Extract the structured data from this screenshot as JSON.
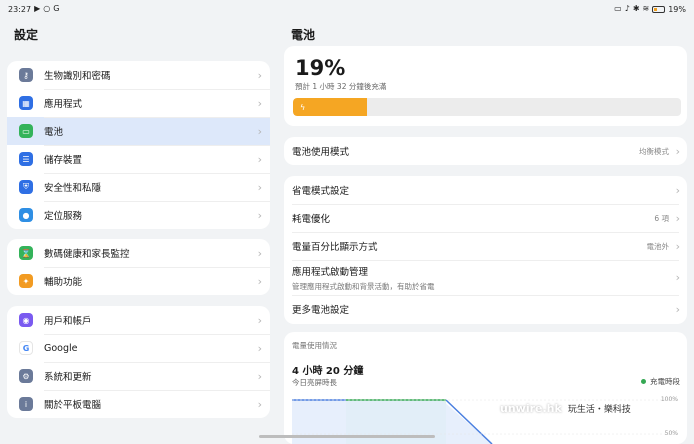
{
  "statusbar": {
    "time": "23:27",
    "battery_pct": "19%"
  },
  "left": {
    "title": "設定",
    "groups": [
      {
        "items": [
          {
            "label": "生物識別和密碼",
            "color": "#6b7a99",
            "glyph": "⚷"
          },
          {
            "label": "應用程式",
            "color": "#2f6fe4",
            "glyph": "▦"
          },
          {
            "label": "電池",
            "color": "#34b35a",
            "glyph": "▭",
            "selected": true
          },
          {
            "label": "儲存裝置",
            "color": "#2f6fe4",
            "glyph": "☰"
          },
          {
            "label": "安全性和私隱",
            "color": "#2f6fe4",
            "glyph": "⛨"
          },
          {
            "label": "定位服務",
            "color": "#2f8fe4",
            "glyph": "●"
          }
        ]
      },
      {
        "items": [
          {
            "label": "數碼健康和家長監控",
            "color": "#34b35a",
            "glyph": "⌛"
          },
          {
            "label": "輔助功能",
            "color": "#f29b22",
            "glyph": "✦"
          }
        ]
      },
      {
        "items": [
          {
            "label": "用戶和帳戶",
            "color": "#7a5af0",
            "glyph": "◉"
          },
          {
            "label": "Google",
            "color": "#ffffff",
            "glyph": "G",
            "text_color": "#4285f4"
          },
          {
            "label": "系統和更新",
            "color": "#6b7a99",
            "glyph": "⚙"
          },
          {
            "label": "關於平板電腦",
            "color": "#6b7a99",
            "glyph": "i"
          }
        ]
      }
    ]
  },
  "right": {
    "title": "電池",
    "battery": {
      "percent": "19%",
      "level": 0.19,
      "eta": "預計 1 小時 32 分鐘後充滿",
      "bar_color": "#f5a623"
    },
    "mode": {
      "label": "電池使用模式",
      "value": "均衡模式"
    },
    "settings": [
      {
        "label": "省電模式設定",
        "value": ""
      },
      {
        "label": "耗電優化",
        "value": "6 項"
      },
      {
        "label": "電量百分比顯示方式",
        "value": "電池外"
      },
      {
        "label": "應用程式啟動管理",
        "value": "",
        "sub": "管理應用程式啟動和背景活動，有助於省電"
      },
      {
        "label": "更多電池設定",
        "value": ""
      }
    ],
    "usage": {
      "heading": "電量使用情況",
      "time": "4 小時 20 分鐘",
      "sub": "今日亮屏時長",
      "legend": "充電時段",
      "ticks": [
        "100%",
        "50%"
      ]
    }
  },
  "watermark": {
    "brand": "unwire.hk",
    "slogan": "玩生活・樂科技"
  }
}
